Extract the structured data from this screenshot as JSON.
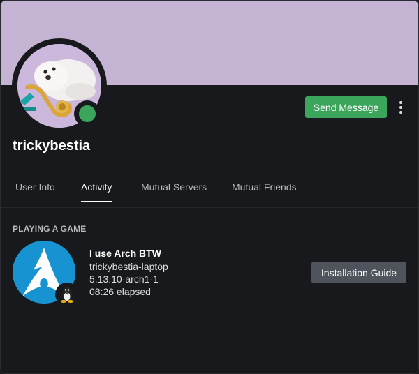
{
  "profile": {
    "username": "trickybestia",
    "status": "online",
    "banner_color": "#c5b3d3",
    "status_color": "#3ba55c"
  },
  "actions": {
    "send_message_label": "Send Message",
    "more_icon": "more-vertical-icon"
  },
  "tabs": [
    {
      "label": "User Info",
      "active": false
    },
    {
      "label": "Activity",
      "active": true
    },
    {
      "label": "Mutual Servers",
      "active": false
    },
    {
      "label": "Mutual Friends",
      "active": false
    }
  ],
  "activity": {
    "section_label": "PLAYING A GAME",
    "large_icon": "arch-linux-logo-icon",
    "small_icon": "tux-penguin-icon",
    "title": "I use Arch BTW",
    "details": "trickybestia-laptop",
    "state": "5.13.10-arch1-1",
    "elapsed": "08:26 elapsed",
    "button_label": "Installation Guide"
  }
}
